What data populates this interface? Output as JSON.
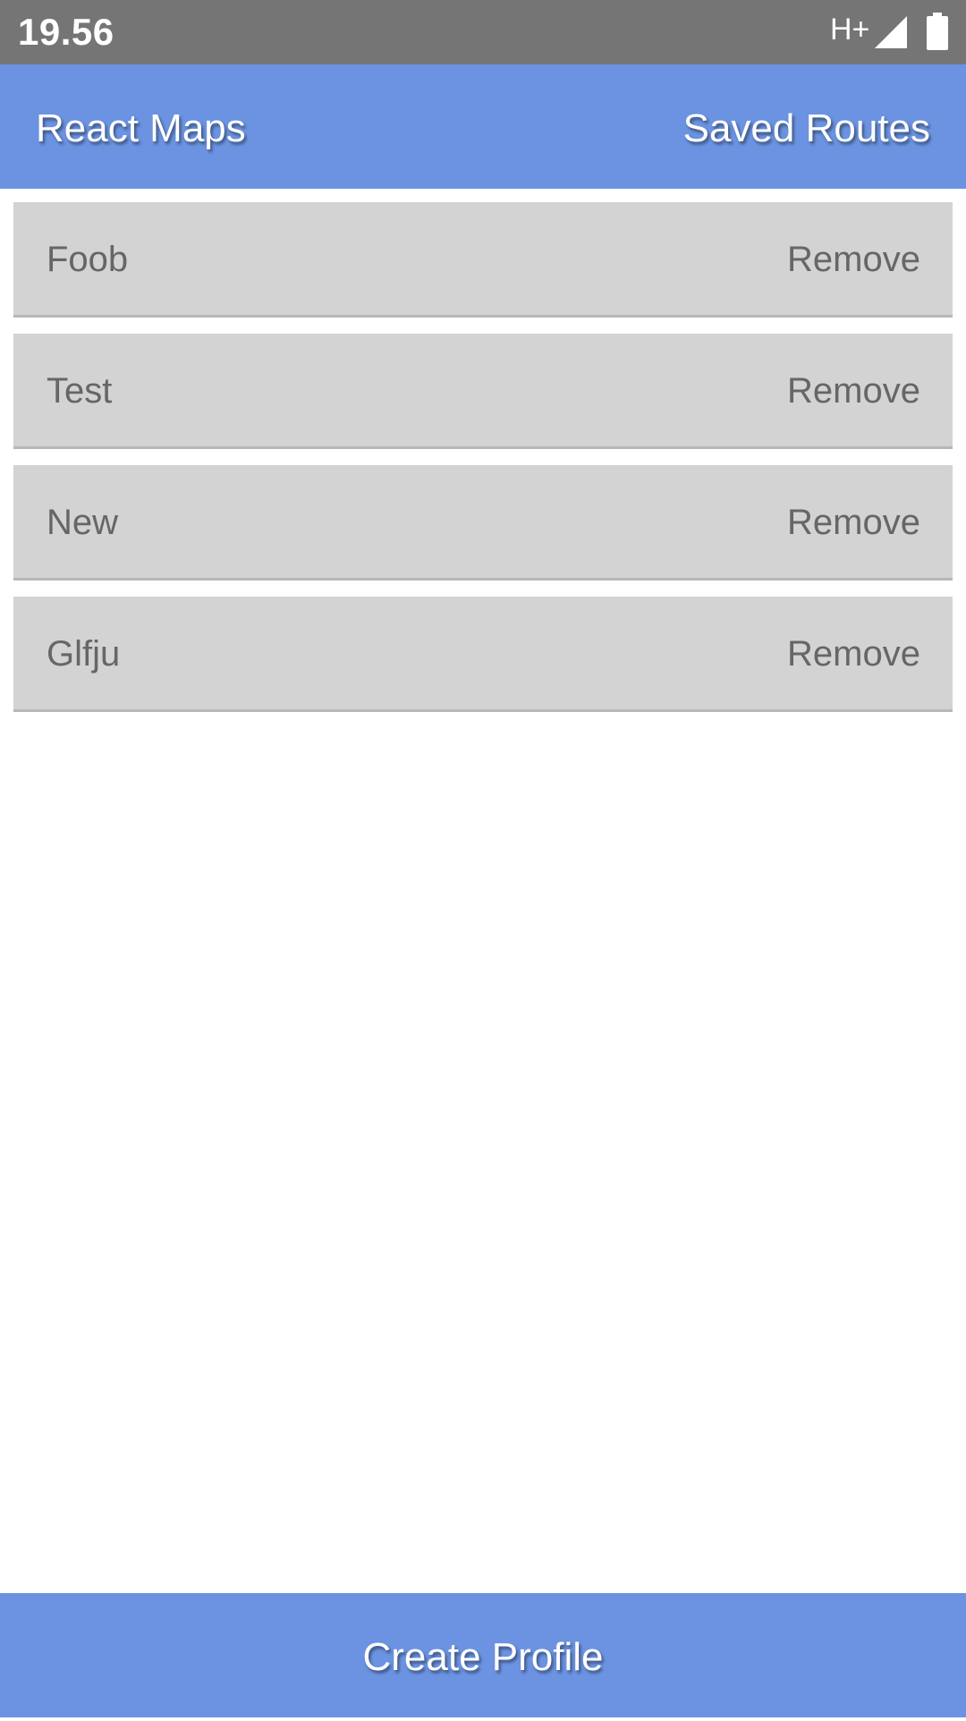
{
  "status_bar": {
    "time": "19.56",
    "network": "H+",
    "icons": [
      "signal-icon",
      "battery-icon"
    ]
  },
  "header": {
    "title": "React Maps",
    "nav_link": "Saved Routes",
    "background_color": "#6b93e1"
  },
  "routes": [
    {
      "name": "Foob",
      "action": "Remove"
    },
    {
      "name": "Test",
      "action": "Remove"
    },
    {
      "name": "New",
      "action": "Remove"
    },
    {
      "name": "Glfju",
      "action": "Remove"
    }
  ],
  "footer": {
    "button_label": "Create Profile"
  }
}
